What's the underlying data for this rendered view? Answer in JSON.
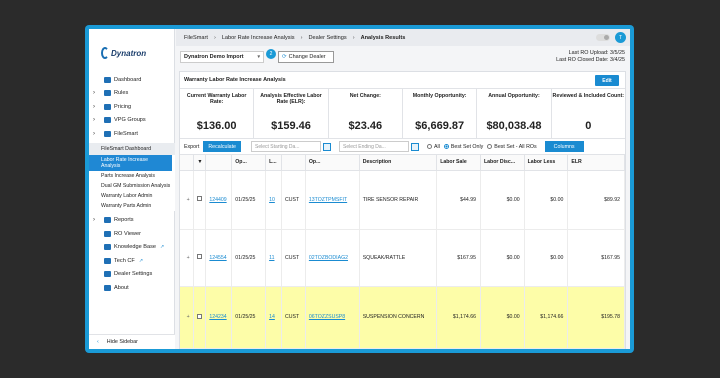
{
  "sidebar": {
    "logo": "Dynatron",
    "items": [
      {
        "label": "Dashboard",
        "icon": "home-icon",
        "chev": false
      },
      {
        "label": "Rules",
        "icon": "rules-icon",
        "chev": true
      },
      {
        "label": "Pricing",
        "icon": "tag-icon",
        "chev": true
      },
      {
        "label": "VPG Groups",
        "icon": "gear-icon",
        "chev": true
      },
      {
        "label": "FileSmart",
        "icon": "file-icon",
        "chev": true
      }
    ],
    "filesmart_head": "FileSmart Dashboard",
    "filesmart_items": [
      "Labor Rate Increase Analysis",
      "Parts Increase Analysis",
      "Dual GM Submission Analysis",
      "Warranty Labor Admin",
      "Warranty Parts Admin"
    ],
    "lower_items": [
      {
        "label": "Reports",
        "icon": "flag-icon",
        "chev": true,
        "ext": ""
      },
      {
        "label": "RO Viewer",
        "icon": "document-icon",
        "chev": false,
        "ext": ""
      },
      {
        "label": "Knowledge Base",
        "icon": "book-icon",
        "chev": false,
        "ext": "↗"
      },
      {
        "label": "Tech CF",
        "icon": "wrench-icon",
        "chev": false,
        "ext": "↗"
      },
      {
        "label": "Dealer Settings",
        "icon": "settings-icon",
        "chev": false,
        "ext": ""
      },
      {
        "label": "About",
        "icon": "info-icon",
        "chev": false,
        "ext": ""
      }
    ],
    "hide_sidebar": "Hide Sidebar"
  },
  "breadcrumb": [
    "FileSmart",
    "Labor Rate Increase Analysis",
    "Dealer Settings",
    "Analysis Results"
  ],
  "user_initial": "T",
  "dealer": {
    "name": "Dynatron Demo Import",
    "badge": "2",
    "change_label": "Change Dealer"
  },
  "ro": {
    "upload": "Last RO Upload: 3/5/25",
    "closed": "Last RO Closed Date: 3/4/25"
  },
  "panel": {
    "title": "Warranty Labor Rate Increase Analysis",
    "edit": "Edit"
  },
  "stats": [
    {
      "label": "Current Warranty Labor Rate:",
      "value": "$136.00"
    },
    {
      "label": "Analysis Effective Labor Rate (ELR):",
      "value": "$159.46"
    },
    {
      "label": "Net Change:",
      "value": "$23.46"
    },
    {
      "label": "Monthly Opportunity:",
      "value": "$6,669.87"
    },
    {
      "label": "Annual Opportunity:",
      "value": "$80,038.48"
    },
    {
      "label": "Reviewed & Included Count:",
      "value": "0"
    }
  ],
  "toolbar": {
    "export": "Export",
    "recalculate": "Recalculate",
    "start_ph": "Select Starting Da...",
    "end_ph": "Select Ending Da...",
    "all": "All",
    "best_only": "Best Set Only",
    "best_all": "Best Set - All ROs",
    "columns": "Columns"
  },
  "table": {
    "headers": [
      "",
      "▼",
      "",
      "Op...",
      "L...",
      "",
      "Op...",
      "Description",
      "Labor Sale",
      "Labor Disc...",
      "Labor Less",
      "ELR"
    ],
    "rows": [
      {
        "ro": "124409",
        "date": "01/25/25",
        "line": "10",
        "type": "CUST",
        "op": "13TOZTPMSFIT",
        "desc": "TIRE SENSOR REPAIR",
        "sale": "$44.99",
        "disc": "$0.00",
        "less": "$0.00",
        "elr": "$89.92"
      },
      {
        "ro": "124554",
        "date": "01/25/25",
        "line": "11",
        "type": "CUST",
        "op": "02TOZBODIAG2",
        "desc": "SQUEAK/RATTLE",
        "sale": "$167.95",
        "disc": "$0.00",
        "less": "$0.00",
        "elr": "$167.95"
      },
      {
        "ro": "124234",
        "date": "01/25/25",
        "line": "14",
        "type": "CUST",
        "op": "06TOZZSUSP8",
        "desc": "SUSPENSION CONCERN",
        "sale": "$1,174.66",
        "disc": "$0.00",
        "less": "$1,174.66",
        "elr": "$195.78"
      }
    ]
  },
  "colors": {
    "accent": "#1a9ad6",
    "button": "#1a8bd1",
    "highlight": "#fdfda8"
  }
}
